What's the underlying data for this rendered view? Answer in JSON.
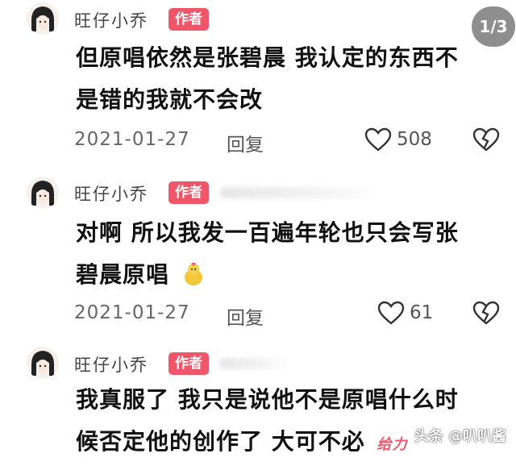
{
  "page_indicator": "1/3",
  "author_badge": "作者",
  "reply_label": "回复",
  "comments": [
    {
      "author": "旺仔小乔",
      "lines": [
        "但原唱依然是张碧晨 我认定的东西不",
        "是错的我就不会改"
      ],
      "date": "2021-01-27",
      "likes": "508"
    },
    {
      "author": "旺仔小乔",
      "lines": [
        "对啊 所以我发一百遍年轮也只会写张",
        "碧晨原唱"
      ],
      "date": "2021-01-27",
      "likes": "61"
    },
    {
      "author": "旺仔小乔",
      "lines": [
        "我真服了 我只是说他不是原唱什么时",
        "候否定他的创作了 大可不必"
      ],
      "sticker_text": "给力"
    }
  ],
  "watermark": "头条 @叭叭酱",
  "icons": {
    "like": "heart-outline-icon",
    "dislike": "broken-heart-icon",
    "sticker": "yellow-bird-emoji"
  },
  "colors": {
    "badge": "#f0566a",
    "page_indicator_bg": "#8e8e8e"
  }
}
